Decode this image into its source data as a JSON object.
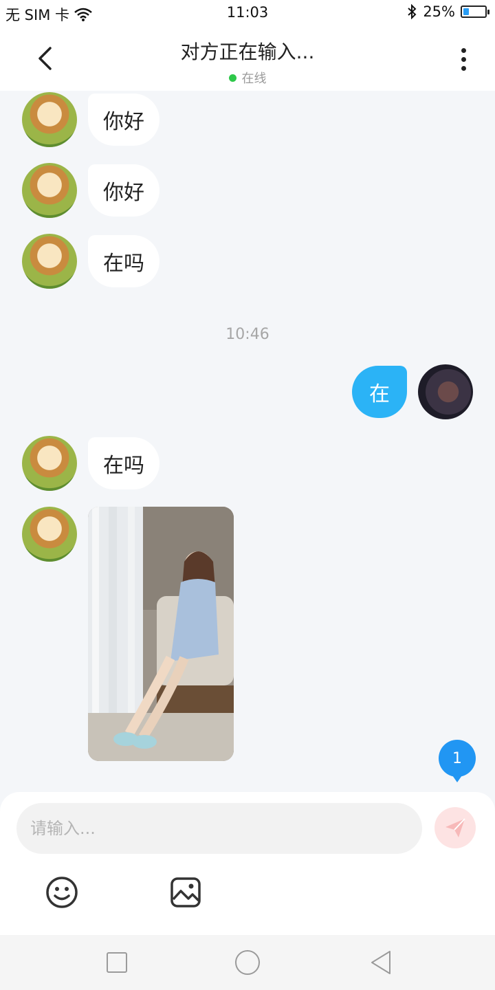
{
  "status_bar": {
    "carrier": "无 SIM 卡",
    "time": "11:03",
    "battery": "25%",
    "battery_level": 0.25
  },
  "header": {
    "title": "对方正在输入...",
    "status": "在线",
    "status_color": "#2ec84a"
  },
  "messages": [
    {
      "side": "in",
      "text": "你好"
    },
    {
      "side": "in",
      "text": "你好"
    },
    {
      "side": "in",
      "text": "在吗"
    },
    {
      "side": "time",
      "text": "10:46"
    },
    {
      "side": "out",
      "text": "在"
    },
    {
      "side": "in",
      "text": "在吗"
    },
    {
      "side": "in",
      "type": "image"
    }
  ],
  "unread_count": "1",
  "composer": {
    "placeholder": "请输入..."
  },
  "colors": {
    "accent": "#2bb3f6",
    "badge": "#2196f3",
    "send": "#fde3e3"
  },
  "icons": [
    "back-icon",
    "more-icon",
    "wifi-icon",
    "bluetooth-icon",
    "send-icon",
    "emoji-icon",
    "image-icon",
    "nav-recents-icon",
    "nav-home-icon",
    "nav-back-icon"
  ]
}
